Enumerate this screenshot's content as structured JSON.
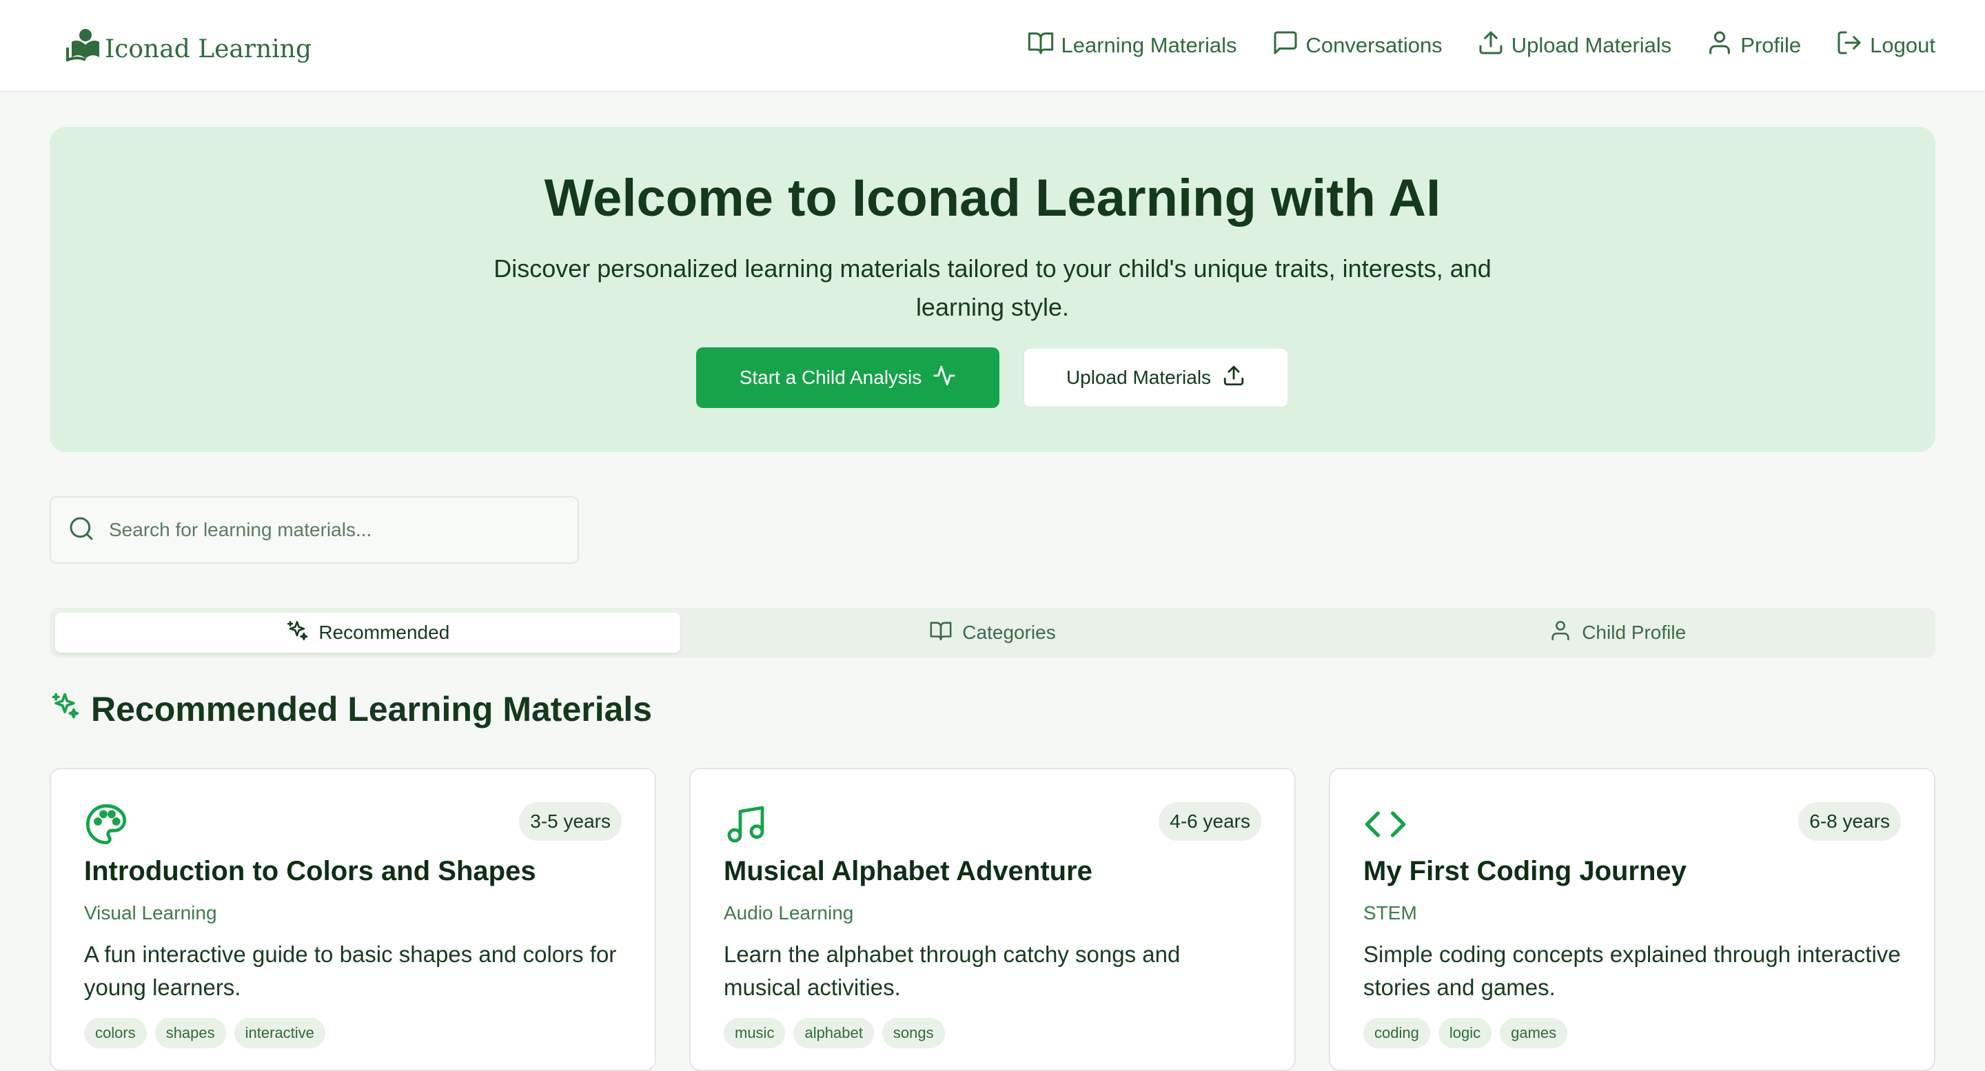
{
  "brand": {
    "name": "Iconad Learning",
    "icon": "reading-person-logo",
    "color": "#2f6b3c"
  },
  "nav": [
    {
      "label": "Learning Materials",
      "icon": "book-open-icon"
    },
    {
      "label": "Conversations",
      "icon": "message-square-icon"
    },
    {
      "label": "Upload Materials",
      "icon": "upload-icon"
    },
    {
      "label": "Profile",
      "icon": "user-icon"
    },
    {
      "label": "Logout",
      "icon": "log-out-icon"
    }
  ],
  "hero": {
    "title": "Welcome to Iconad Learning with AI",
    "subtitle": "Discover personalized learning materials tailored to your child's unique traits, interests, and learning style.",
    "primary_button": "Start a Child Analysis",
    "secondary_button": "Upload Materials",
    "background": "#dcf1e0",
    "accent": "#16a34a"
  },
  "search": {
    "placeholder": "Search for learning materials...",
    "value": ""
  },
  "tabs": [
    {
      "label": "Recommended",
      "icon": "sparkles-icon",
      "active": true
    },
    {
      "label": "Categories",
      "icon": "book-open-icon",
      "active": false
    },
    {
      "label": "Child Profile",
      "icon": "user-icon",
      "active": false
    }
  ],
  "section": {
    "title": "Recommended Learning Materials",
    "icon": "sparkles-icon"
  },
  "cards": [
    {
      "icon": "palette-icon",
      "age": "3-5 years",
      "title": "Introduction to Colors and Shapes",
      "category": "Visual Learning",
      "description": "A fun interactive guide to basic shapes and colors for young learners.",
      "tags": [
        "colors",
        "shapes",
        "interactive"
      ]
    },
    {
      "icon": "music-note-icon",
      "age": "4-6 years",
      "title": "Musical Alphabet Adventure",
      "category": "Audio Learning",
      "description": "Learn the alphabet through catchy songs and musical activities.",
      "tags": [
        "music",
        "alphabet",
        "songs"
      ]
    },
    {
      "icon": "code-icon",
      "age": "6-8 years",
      "title": "My First Coding Journey",
      "category": "STEM",
      "description": "Simple coding concepts explained through interactive stories and games.",
      "tags": [
        "coding",
        "logic",
        "games"
      ]
    }
  ]
}
